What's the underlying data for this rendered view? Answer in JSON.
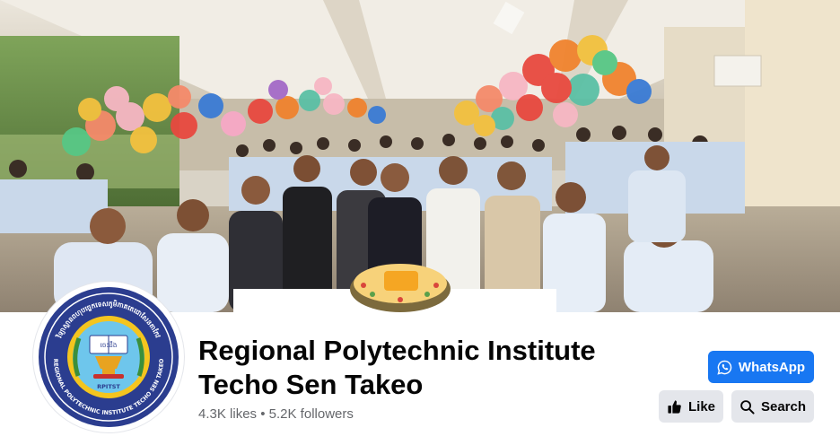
{
  "cover": {
    "image_alt": "Staff and students gathered around a decorated cake in a building corridor with colorful balloons"
  },
  "profile": {
    "logo_text_top": "វិទ្យាស្ថានពហុបច្ចេកទេសភូមិភាគតេជោសែនតាកែវ",
    "logo_text_bottom": "REGIONAL POLYTECHNIC INSTITUTE TECHO SEN TAKEO",
    "logo_abbr": "RPITST",
    "logo_book_text": "ចេះដឹង"
  },
  "page": {
    "name_line1": "Regional Polytechnic Institute",
    "name_line2": "Techo Sen Takeo",
    "likes": "4.3K likes",
    "separator": "•",
    "followers": "5.2K followers"
  },
  "actions": {
    "whatsapp_label": "WhatsApp",
    "like_label": "Like",
    "search_label": "Search"
  },
  "colors": {
    "primary": "#1877f2",
    "secondary_button": "#e4e6eb",
    "text_primary": "#050505",
    "text_secondary": "#65676b"
  },
  "icons": {
    "whatsapp": "whatsapp-icon",
    "like": "thumbs-up-icon",
    "search": "search-icon"
  }
}
